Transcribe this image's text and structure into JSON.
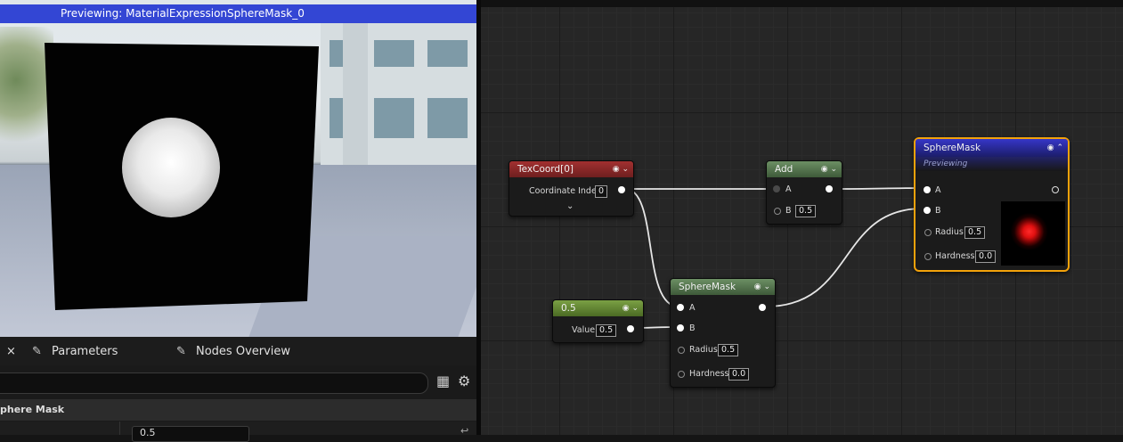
{
  "preview": {
    "title": "Previewing: MaterialExpressionSphereMask_0"
  },
  "details_panel": {
    "tabs": [
      {
        "label": "×"
      },
      {
        "label": "Parameters",
        "icon": "pen-icon"
      },
      {
        "label": "Nodes Overview",
        "icon": "pen-icon"
      }
    ],
    "search": {
      "placeholder": ""
    },
    "category_label": "phere Mask",
    "property_value": "0.5"
  },
  "graph": {
    "nodes": {
      "texcoord": {
        "title": "TexCoord[0]",
        "pin_label": "Coordinate Index",
        "pin_value": "0",
        "header_color": "#8e2a2a"
      },
      "add": {
        "title": "Add",
        "pin_a": "A",
        "pin_b": "B",
        "b_value": "0.5",
        "header_color": "#5f7f57"
      },
      "spheremask_main": {
        "title": "SphereMask",
        "status": "Previewing",
        "pin_a": "A",
        "pin_b": "B",
        "pin_radius": "Radius",
        "radius_value": "0.5",
        "pin_hardness": "Hardness",
        "hardness_value": "0.0",
        "header_color": "#2b2fa5",
        "accent": "#f3a20a"
      },
      "constant": {
        "title": "0.5",
        "pin_label": "Value",
        "pin_value": "0.5",
        "header_color": "#6b8a3c"
      },
      "spheremask_small": {
        "title": "SphereMask",
        "pin_a": "A",
        "pin_b": "B",
        "pin_radius": "Radius",
        "radius_value": "0.5",
        "pin_hardness": "Hardness",
        "hardness_value": "0.0",
        "header_color": "#5f7f57"
      }
    }
  }
}
